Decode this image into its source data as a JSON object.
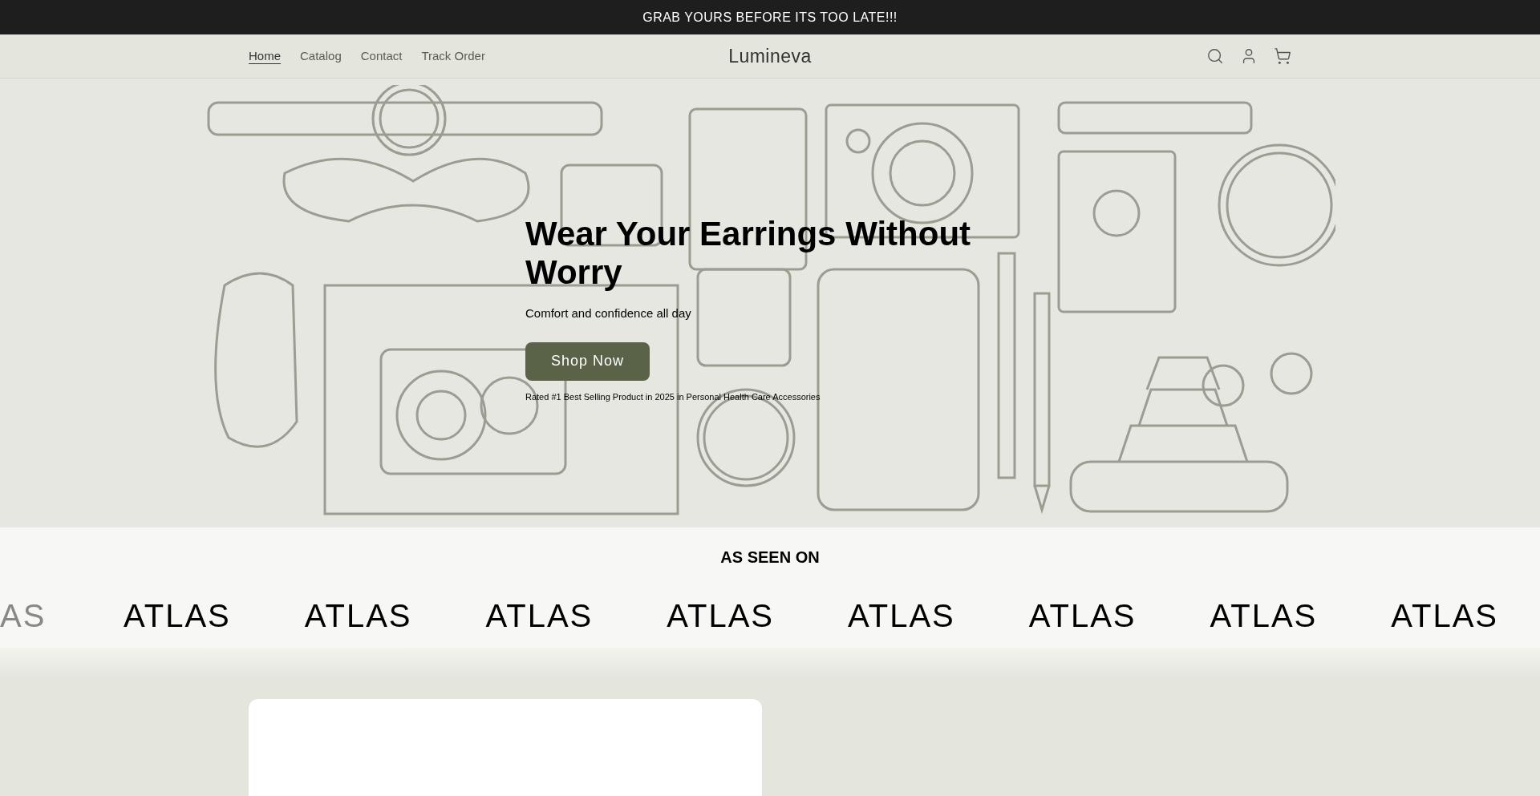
{
  "announcement": "GRAB YOURS BEFORE ITS TOO LATE!!!",
  "nav": [
    {
      "label": "Home",
      "selected": true
    },
    {
      "label": "Catalog",
      "selected": false
    },
    {
      "label": "Contact",
      "selected": false
    },
    {
      "label": "Track Order",
      "selected": false
    }
  ],
  "brand": "Lumineva",
  "hero": {
    "heading": "Wear Your Earrings Without Worry",
    "subheading": "Comfort and confidence all day",
    "button": "Shop Now",
    "note": "Rated #1 Best Selling Product in 2025 in Personal Health Care Accessories"
  },
  "press": {
    "heading": "AS SEEN ON",
    "logos": [
      "AS",
      "ATLAS",
      "ATLAS",
      "ATLAS",
      "ATLAS",
      "ATLAS",
      "ATLAS",
      "ATLAS",
      "ATLAS"
    ]
  }
}
